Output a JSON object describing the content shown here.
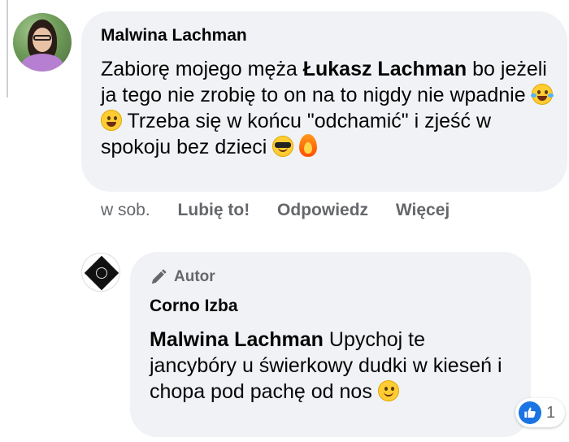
{
  "comments": [
    {
      "author": "Malwina Lachman",
      "text_part1": "Zabiorę mojego męża ",
      "mention": "Łukasz Lachman",
      "text_part2": " bo jeżeli ja tego nie zrobię to on na to nigdy nie wpadnie ",
      "text_part3": " Trzeba się w końcu \"odchamić\" i zjeść w spokoju bez dzieci ",
      "emojis": [
        "tears-of-joy-emoji",
        "grinning-face-emoji",
        "sunglasses-face-emoji",
        "fire-emoji"
      ],
      "actions": {
        "time": "w sob.",
        "like": "Lubię to!",
        "reply": "Odpowiedz",
        "more": "Więcej"
      }
    },
    {
      "badge": "Autor",
      "author": "Corno Izba",
      "mention": "Malwina Lachman",
      "text": " Upychoj te jancybóry u świerkowy dudki w kieseń i chopa pod pachę od nos ",
      "emojis": [
        "slightly-smiling-face-emoji"
      ],
      "reactions": {
        "icon": "like-icon",
        "count": "1"
      }
    }
  ],
  "colors": {
    "bubble": "#f0f2f5",
    "secondary_text": "#65676b",
    "like_blue": "#1b74e4"
  }
}
